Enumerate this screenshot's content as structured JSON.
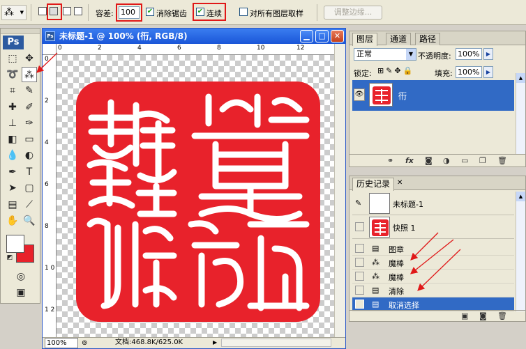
{
  "options_bar": {
    "tolerance_label": "容差:",
    "tolerance_value": "100",
    "anti_alias_label": "消除锯齿",
    "anti_alias_checked": true,
    "contiguous_label": "连续",
    "contiguous_checked": true,
    "sample_all_layers_label": "对所有图层取样",
    "sample_all_layers_checked": false,
    "refine_edge_label": "调整边缘..."
  },
  "toolbox": {
    "logo": "Ps"
  },
  "document": {
    "title": "未标题-1 @ 100% (衎, RGB/8)",
    "zoom": "100%",
    "doc_info": "文档:468.8K/625.0K",
    "ruler_h": [
      "0",
      "2",
      "4",
      "6",
      "8",
      "10",
      "12"
    ],
    "ruler_v": [
      "0",
      "2",
      "4",
      "6",
      "8",
      "1 0",
      "1 2"
    ]
  },
  "layers_panel": {
    "tabs": [
      "图层",
      "通道",
      "路径"
    ],
    "blend_mode": "正常",
    "opacity_label": "不透明度:",
    "opacity_value": "100%",
    "lock_label": "锁定:",
    "fill_label": "填充:",
    "fill_value": "100%",
    "layers": [
      {
        "name": "衎",
        "visible": true,
        "selected": true
      }
    ]
  },
  "history_panel": {
    "tab": "历史记录",
    "snapshots": [
      {
        "label": "未标题-1"
      },
      {
        "label": "快照 1"
      }
    ],
    "states": [
      {
        "label": "图章",
        "icon": "stamp-icon"
      },
      {
        "label": "魔棒",
        "icon": "magic-wand-icon"
      },
      {
        "label": "魔棒",
        "icon": "magic-wand-icon"
      },
      {
        "label": "清除",
        "icon": "stamp-icon"
      },
      {
        "label": "取消选择",
        "icon": "stamp-icon",
        "current": true
      }
    ]
  },
  "colors": {
    "foreground": "#ffffff",
    "background": "#e8222b",
    "seal_red": "#e8222b",
    "selection_blue": "#316ac5",
    "annotation_red": "#e01818"
  }
}
